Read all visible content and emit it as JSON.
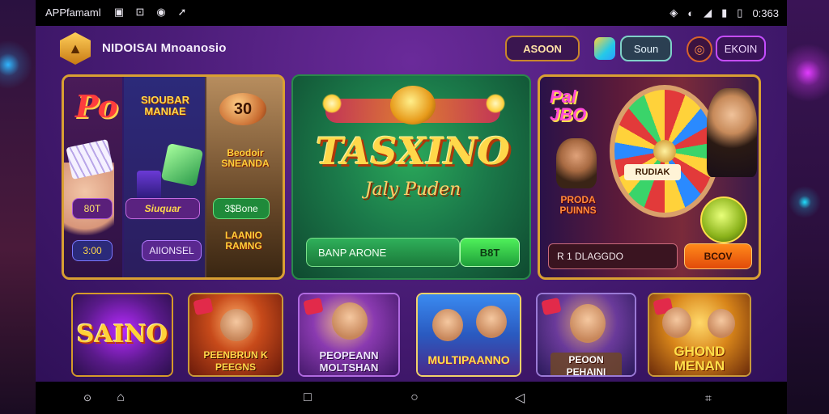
{
  "status_bar": {
    "app_label": "APPfamaml",
    "time": "0:363"
  },
  "header": {
    "app_title": "NIDOISAI Mnoanosio",
    "asoon_button": "ASOON",
    "soun_button": "Soun",
    "ekoin_button": "EKOIN"
  },
  "banner_left": {
    "logo": "Po",
    "title_top": "SIOUBAR MANIAE",
    "coin_value": "30",
    "title_mid": "Beodoir SNEANDA",
    "chip_1": "80T",
    "chip_2": "Siuquar",
    "chip_3": "3$Bone",
    "chip_4": "3:00",
    "chip_5": "AIIONSEL",
    "title_bottom": "LAANIO RAMNG"
  },
  "banner_center": {
    "title": "TASXINO",
    "subtitle": "Jaly Puden",
    "input_value": "BANP ARONE",
    "button": "B8T"
  },
  "banner_right": {
    "logo": "Pal JBO",
    "wheel_label": "RUDIAK",
    "title_side": "PRODA PUINNS",
    "input_value": "R 1 DLAGGDO",
    "button": "BCOV"
  },
  "tiles": [
    {
      "label": "SAINO"
    },
    {
      "label": "PEENBRUN K PEEGNS"
    },
    {
      "label": "PEOPEANN MOLTSHAN"
    },
    {
      "label": "MULTIPAANNO"
    },
    {
      "label": "PEOON PEHAINI"
    },
    {
      "label": "GHOND MENAN"
    }
  ],
  "icons": {
    "logo": "hexagon-badge-icon",
    "nav_home": "home-icon",
    "nav_recents": "square-icon",
    "nav_home_circle": "circle-icon",
    "nav_back": "triangle-back-icon"
  },
  "colors": {
    "screen_bg": "#4b1d78",
    "gold_border": "#d9a032",
    "green_button": "#1fa03a",
    "orange_button": "#e24a0a"
  }
}
